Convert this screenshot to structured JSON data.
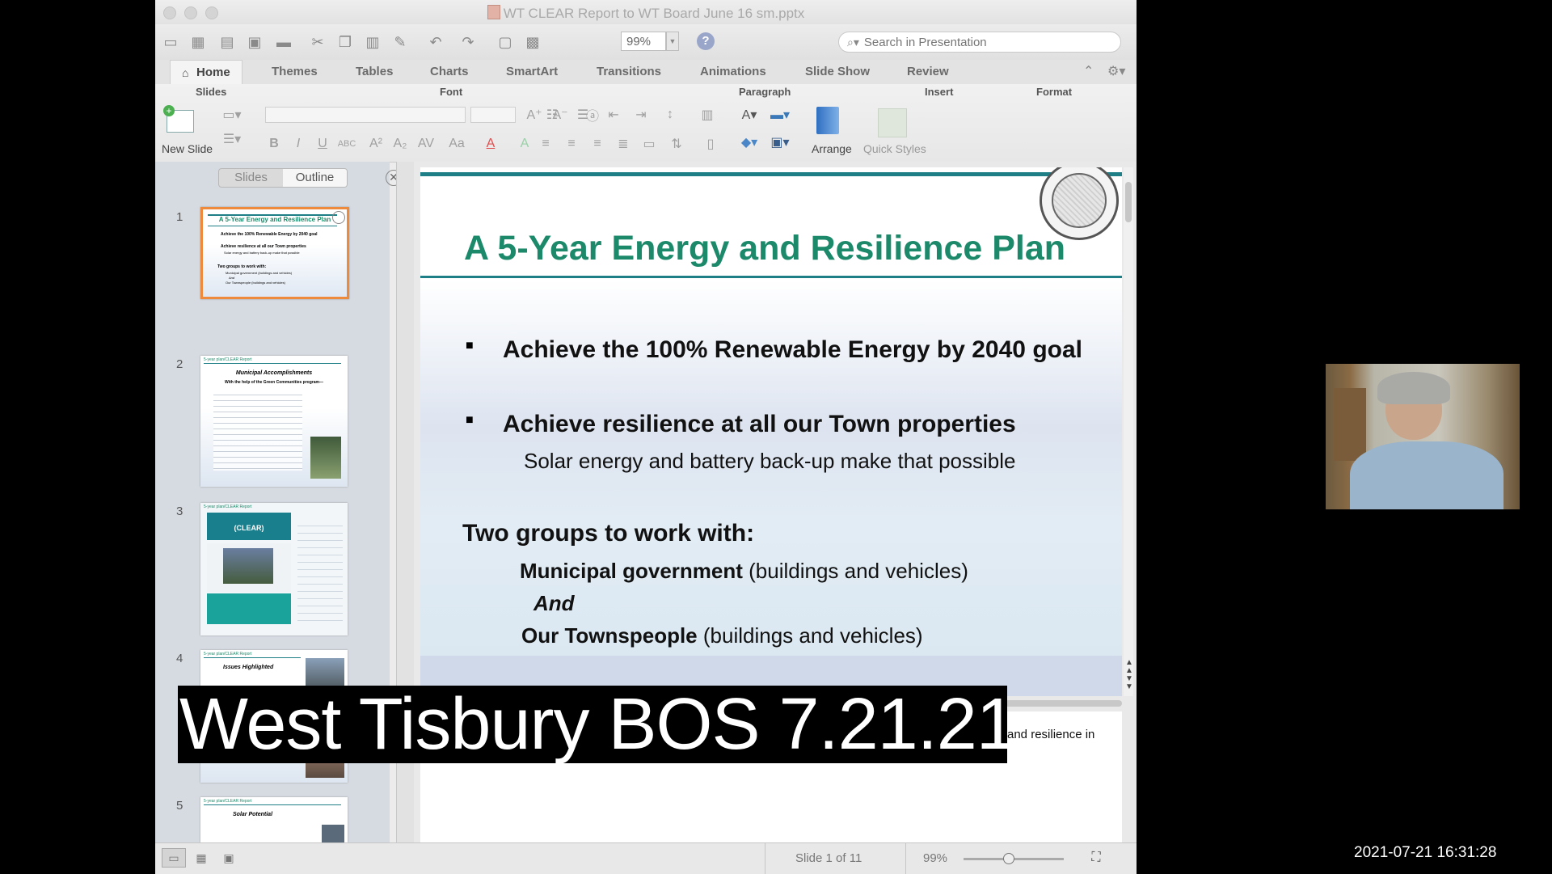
{
  "window": {
    "title": "WT CLEAR Report to WT Board June 16 sm.pptx"
  },
  "toolbar": {
    "zoom": "99%",
    "search_placeholder": "Search in Presentation"
  },
  "tabs": [
    "Home",
    "Themes",
    "Tables",
    "Charts",
    "SmartArt",
    "Transitions",
    "Animations",
    "Slide Show",
    "Review"
  ],
  "ribbon": {
    "groups": {
      "slides": "Slides",
      "font": "Font",
      "paragraph": "Paragraph",
      "insert": "Insert",
      "format": "Format"
    },
    "new_slide": "New Slide",
    "arrange": "Arrange",
    "quick_styles": "Quick Styles"
  },
  "pane": {
    "tab_slides": "Slides",
    "tab_outline": "Outline"
  },
  "thumbnails": [
    {
      "num": "1",
      "header": "",
      "title": "A 5-Year Energy and Resilience Plan",
      "lines": [
        "Achieve the 100% Renewable Energy by 2040 goal",
        "Achieve resilience at all our Town properties",
        "Solar energy and battery back-up make that possible",
        "Two groups to work with:",
        "Municipal government (buildings and vehicles)",
        "And",
        "Our Townspeople (buildings and vehicles)"
      ]
    },
    {
      "num": "2",
      "header": "5-year plan/CLEAR Report",
      "title": "Municipal Accomplishments",
      "lines": [
        "With the help of the Green Communities program—"
      ]
    },
    {
      "num": "3",
      "header": "5-year plan/CLEAR Report",
      "title": "(CLEAR)",
      "lines": []
    },
    {
      "num": "4",
      "header": "5-year plan/CLEAR Report",
      "title": "Issues Highlighted",
      "lines": []
    },
    {
      "num": "5",
      "header": "5-year plan/CLEAR Report",
      "title": "Solar Potential",
      "lines": []
    }
  ],
  "slide": {
    "title": "A 5-Year Energy and Resilience Plan",
    "bullets": [
      "Achieve the 100% Renewable Energy by 2040 goal",
      "Achieve resilience at all our Town properties"
    ],
    "sub": "Solar energy and battery back-up make that possible",
    "groups_heading": "Two groups to work with:",
    "group1_bold": "Municipal government",
    "group1_rest": " (buildings and vehicles)",
    "and": "And",
    "group2_bold": "Our Townspeople",
    "group2_rest": " (buildings and vehicles)"
  },
  "notes": {
    "text": "and resilience in"
  },
  "status": {
    "slide_indicator": "Slide 1 of 11",
    "zoom": "99%",
    "zoom_level": 0.45
  },
  "caption": "West Tisbury BOS 7.21.21",
  "timestamp": "2021-07-21  16:31:28",
  "colors": {
    "title_green": "#1c8a6a",
    "teal_rule": "#1f7f86",
    "thumb_selected": "#ee8a3c"
  }
}
